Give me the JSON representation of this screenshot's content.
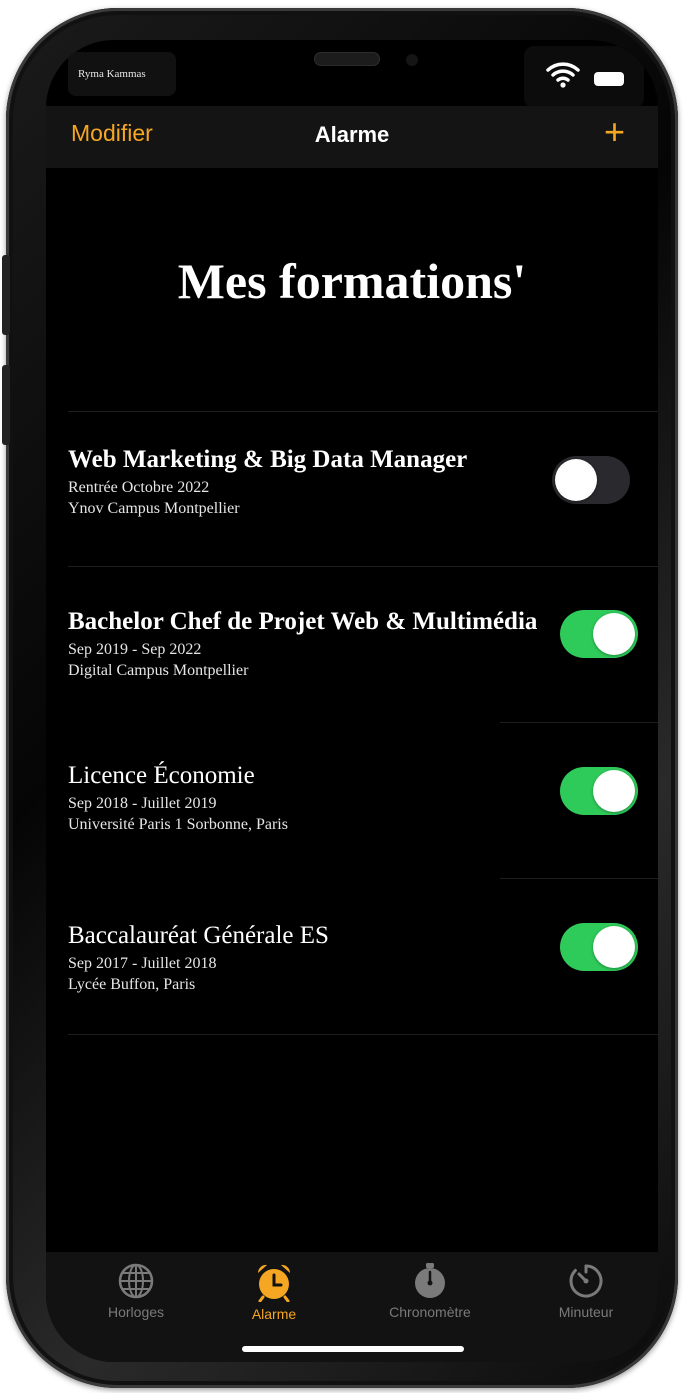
{
  "status": {
    "carrier": "Ryma Kammas"
  },
  "nav": {
    "left_label": "Modifier",
    "title": "Alarme",
    "add_symbol": "+"
  },
  "page_title": "Mes formations'",
  "items": [
    {
      "title": "Web Marketing & Big Data Manager",
      "line1": "Rentrée Octobre 2022",
      "line2": "Ynov Campus Montpellier",
      "enabled": false
    },
    {
      "title": "Bachelor Chef de Projet Web & Multimédia",
      "line1": "Sep 2019 - Sep 2022",
      "line2": "Digital Campus Montpellier",
      "enabled": true
    },
    {
      "title": "Licence Économie",
      "line1": "Sep 2018 - Juillet 2019",
      "line2": "Université Paris 1 Sorbonne, Paris",
      "enabled": true
    },
    {
      "title": "Baccalauréat Générale ES",
      "line1": "Sep 2017 - Juillet 2018",
      "line2": "Lycée Buffon, Paris",
      "enabled": true
    }
  ],
  "tabs": [
    {
      "label": "Horloges",
      "icon": "globe-icon",
      "active": false
    },
    {
      "label": "Alarme",
      "icon": "alarm-clock-icon",
      "active": true
    },
    {
      "label": "Chronomètre",
      "icon": "stopwatch-icon",
      "active": false
    },
    {
      "label": "Minuteur",
      "icon": "timer-icon",
      "active": false
    }
  ],
  "colors": {
    "accent": "#f5a623",
    "toggle_on": "#2fcb5a",
    "toggle_off": "#2a2a2e",
    "tab_inactive": "#7a7a7a",
    "background": "#000000"
  }
}
